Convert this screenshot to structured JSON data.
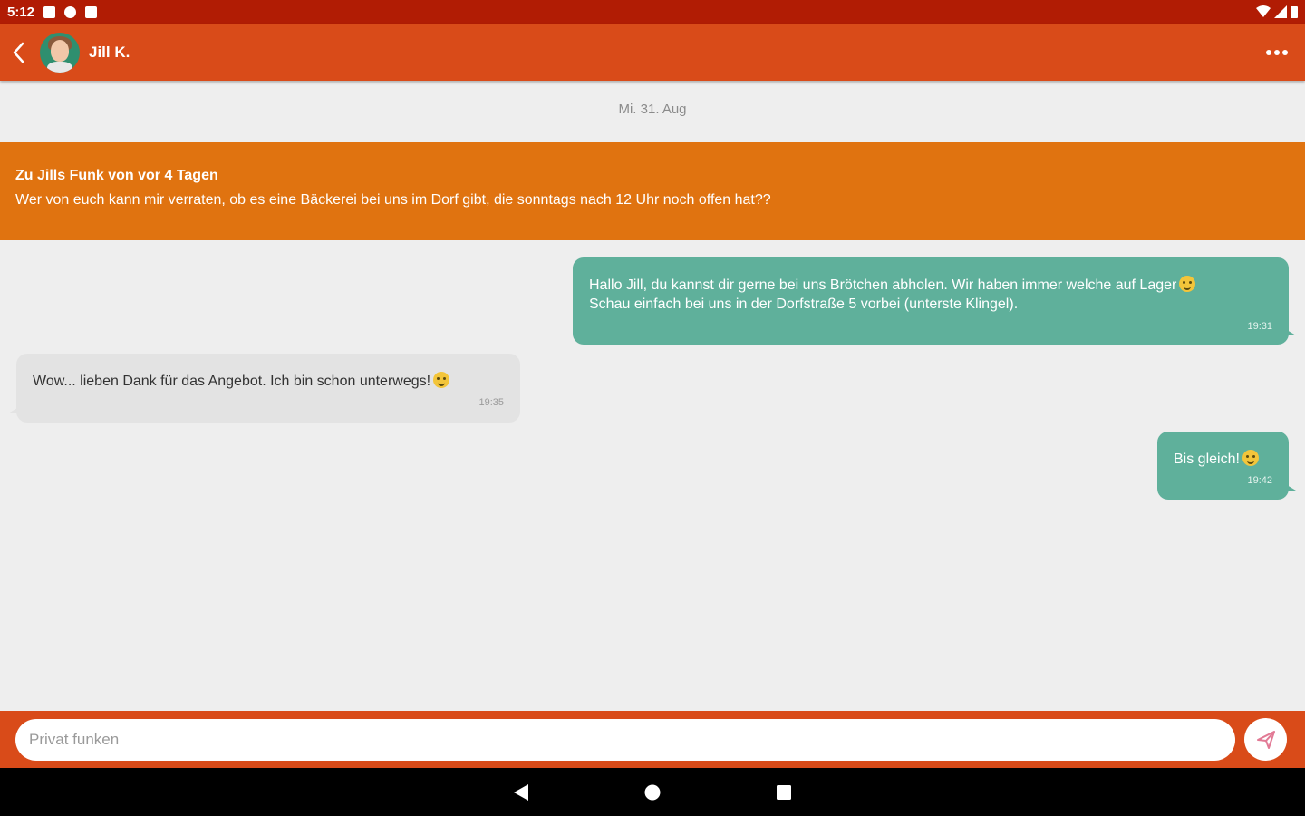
{
  "status_bar": {
    "time": "5:12"
  },
  "header": {
    "contact_name": "Jill K."
  },
  "chat": {
    "date": "Mi. 31. Aug",
    "quote": {
      "title": "Zu Jills Funk von vor 4 Tagen",
      "text": "Wer von euch kann mir verraten, ob es eine Bäckerei bei uns im Dorf gibt, die sonntags nach 12 Uhr noch offen hat??"
    },
    "messages": [
      {
        "direction": "outgoing",
        "line1": "Hallo Jill, du kannst dir gerne bei uns Brötchen abholen. Wir haben immer welche auf Lager",
        "line2": "Schau einfach bei uns in der Dorfstraße 5 vorbei (unterste Klingel).",
        "time": "19:31"
      },
      {
        "direction": "incoming",
        "line1": "Wow... lieben Dank für das Angebot. Ich bin schon unterwegs!",
        "time": "19:35"
      },
      {
        "direction": "outgoing",
        "line1": "Bis gleich!",
        "time": "19:42"
      }
    ]
  },
  "composer": {
    "placeholder": "Privat funken"
  },
  "colors": {
    "status_bar": "#b11c04",
    "app_bar": "#d94b19",
    "quote_banner": "#e07310",
    "outgoing_bubble": "#5fb09b",
    "incoming_bubble": "#e3e3e3"
  },
  "icons": {
    "back": "chevron-left-icon",
    "menu": "more-horizontal-icon",
    "send": "send-icon"
  }
}
